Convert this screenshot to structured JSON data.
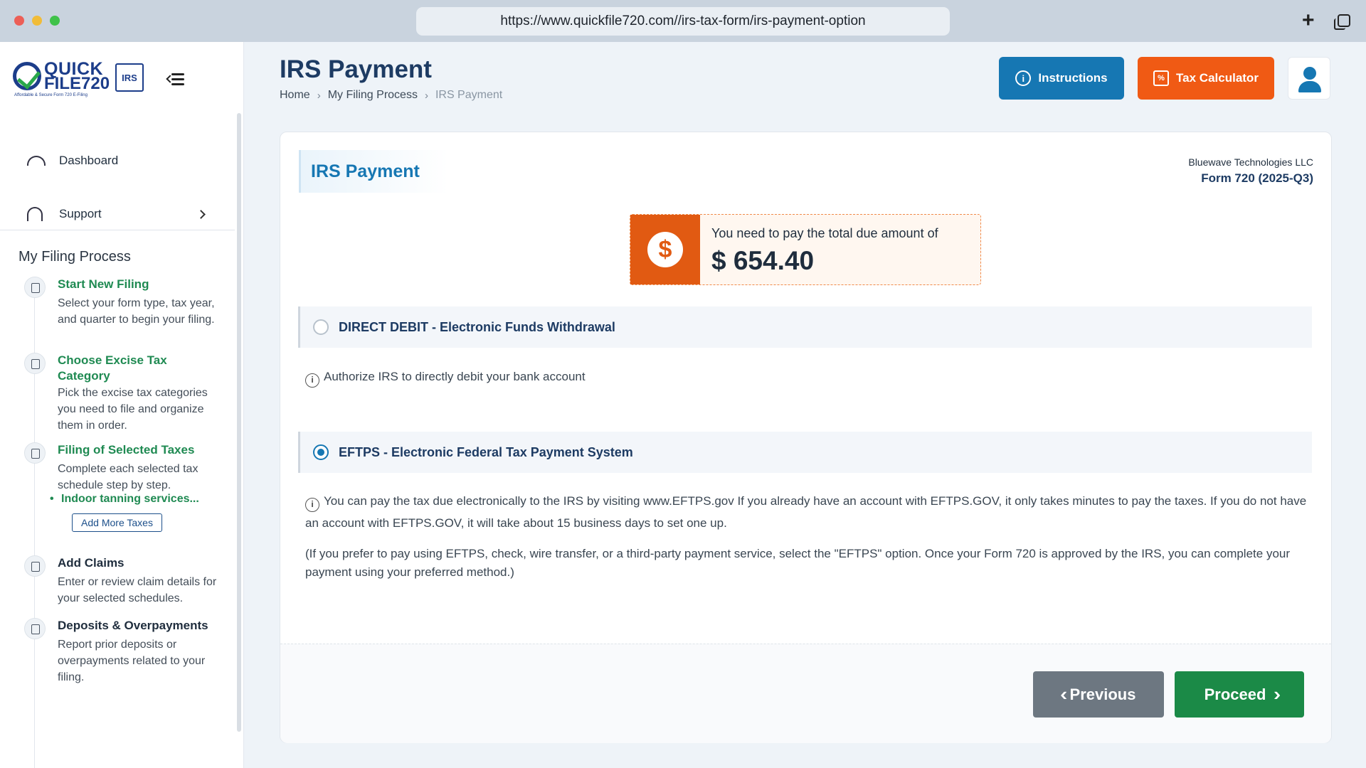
{
  "browser": {
    "url": "https://www.quickfile720.com//irs-tax-form/irs-payment-option",
    "new_tab_glyph": "+"
  },
  "logo": {
    "line1": "QUICK",
    "line2": "FILE720",
    "tagline": "Affordable & Secure Form 720 E-Filing",
    "badge": "IRS"
  },
  "sidebar": {
    "nav": [
      {
        "label": "Dashboard",
        "icon": "dashboard-icon"
      },
      {
        "label": "Support",
        "icon": "headset-icon"
      }
    ],
    "section_title": "My Filing Process",
    "steps": [
      {
        "title": "Start New Filing",
        "desc": "Select your form type, tax year, and quarter to begin your filing.",
        "icon": "document-icon"
      },
      {
        "title": "Choose Excise Tax Category",
        "desc": "Pick the excise tax categories you need to file and organize them in order.",
        "icon": "layers-icon"
      },
      {
        "title": "Filing of Selected Taxes",
        "desc": "Complete each selected tax schedule step by step.",
        "icon": "list-icon"
      },
      {
        "title": "Add Claims",
        "desc": "Enter or review claim details for your selected schedules.",
        "icon": "claim-icon"
      },
      {
        "title": "Deposits & Overpayments",
        "desc": "Report prior deposits or overpayments related to your filing.",
        "icon": "cash-icon"
      }
    ],
    "sub_item": "Indoor tanning services...",
    "add_more_label": "Add More Taxes"
  },
  "header": {
    "title": "IRS Payment",
    "breadcrumb": [
      "Home",
      "My Filing Process",
      "IRS Payment"
    ],
    "instructions_label": "Instructions",
    "calculator_label": "Tax Calculator"
  },
  "card": {
    "title": "IRS Payment",
    "company": "Bluewave Technologies LLC",
    "form": "Form 720 (2025-Q3)",
    "due_text": "You need to pay the total due amount of",
    "due_amount": "$ 654.40",
    "options": [
      {
        "label": "DIRECT DEBIT - Electronic Funds Withdrawal",
        "selected": false
      },
      {
        "label": "EFTPS - Electronic Federal Tax Payment System",
        "selected": true
      }
    ],
    "debit_info": "Authorize IRS to directly debit your bank account",
    "eftps_info": "You can pay the tax due electronically to the IRS by visiting www.EFTPS.gov If you already have an account with EFTPS.GOV, it only takes minutes to pay the taxes. If you do not have an account with EFTPS.GOV, it will take about 15 business days to set one up.",
    "eftps_note": "(If you prefer to pay using EFTPS, check, wire transfer, or a third-party payment service, select the \"EFTPS\" option. Once your Form 720 is approved by the IRS, you can complete your payment using your preferred method.)",
    "previous_label": "Previous",
    "proceed_label": "Proceed"
  },
  "colors": {
    "primary_blue": "#1677b3",
    "orange": "#f05a14",
    "green": "#1b8a47",
    "navy": "#1d3b63"
  }
}
